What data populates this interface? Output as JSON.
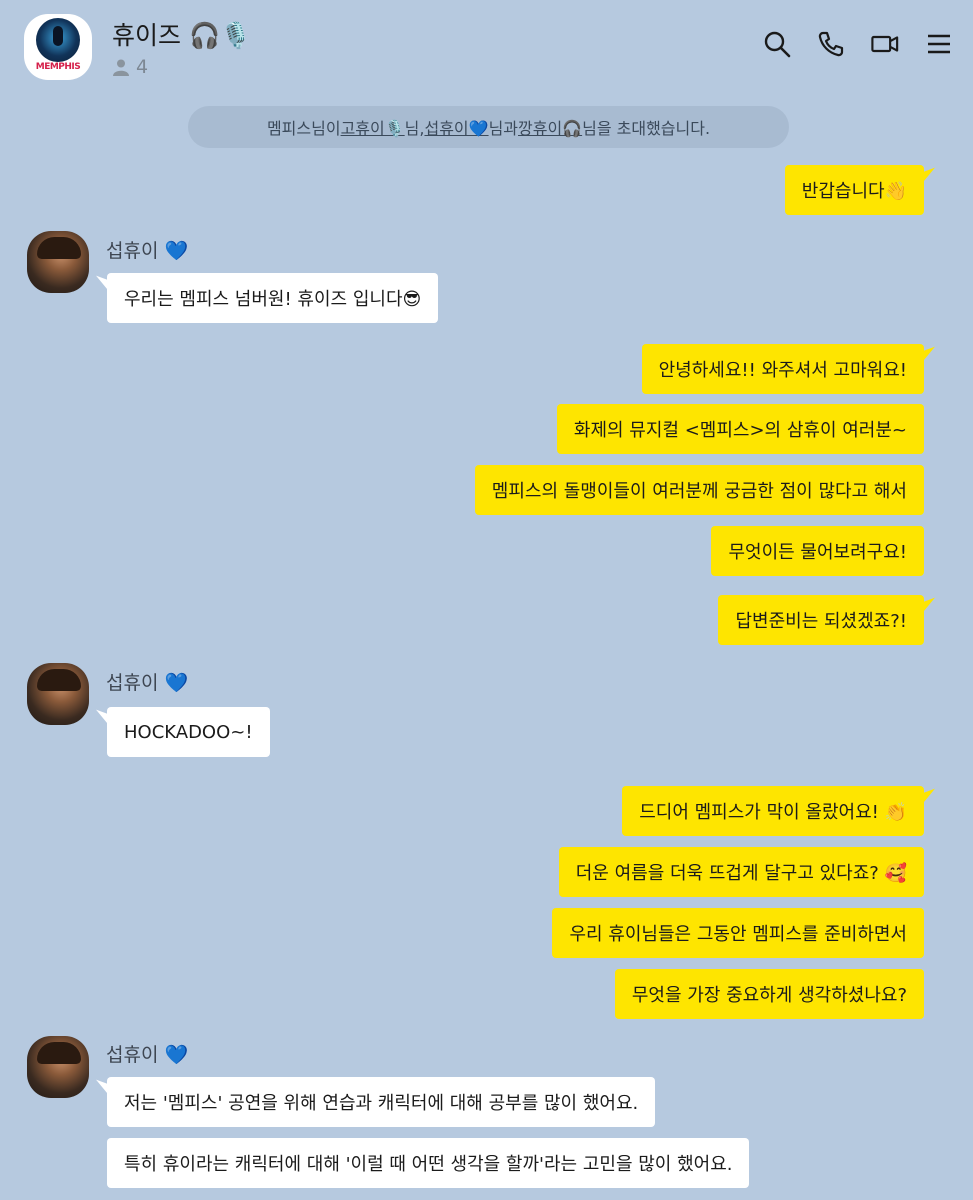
{
  "header": {
    "room_title": "휴이즈 🎧🎙️",
    "member_count": "4",
    "avatar_brand": "MEMPHIS"
  },
  "system_message": {
    "prefix": "멤피스님이 ",
    "user1": "고휴이🎙️",
    "mid1": "님, ",
    "user2": "섭휴이💙",
    "mid2": "님과 ",
    "user3": "깡휴이🎧",
    "suffix": "님을 초대했습니다."
  },
  "messages": [
    {
      "side": "out",
      "text": "반갑습니다👋"
    },
    {
      "side": "in",
      "sender": "섭휴이 💙",
      "text": "우리는 멤피스 넘버원! 휴이즈 입니다😎"
    },
    {
      "side": "out",
      "text": "안녕하세요!! 와주셔서 고마워요!"
    },
    {
      "side": "out",
      "text": "화제의 뮤지컬 <멤피스>의 삼휴이 여러분~"
    },
    {
      "side": "out",
      "text": "멤피스의 돌맹이들이 여러분께 궁금한 점이 많다고 해서"
    },
    {
      "side": "out",
      "text": "무엇이든 물어보려구요!"
    },
    {
      "side": "out",
      "text": "답변준비는 되셨겠죠?!"
    },
    {
      "side": "in",
      "sender": "섭휴이 💙",
      "text": "HOCKADOO~!"
    },
    {
      "side": "out",
      "text": "드디어 멤피스가 막이 올랐어요! 👏"
    },
    {
      "side": "out",
      "text": "더운 여름을 더욱 뜨겁게 달구고 있다죠? 🥰"
    },
    {
      "side": "out",
      "text": "우리 휴이님들은 그동안 멤피스를 준비하면서"
    },
    {
      "side": "out",
      "text": "무엇을 가장 중요하게 생각하셨나요?"
    },
    {
      "side": "in",
      "sender": "섭휴이 💙",
      "text": "저는 '멤피스' 공연을 위해 연습과 캐릭터에 대해 공부를 많이 했어요."
    },
    {
      "side": "in",
      "text": "특히 휴이라는 캐릭터에 대해 '이럴 때 어떤 생각을 할까'라는 고민을 많이 했어요."
    }
  ],
  "icons": {
    "search": "search-icon",
    "call": "phone-icon",
    "video": "video-call-icon",
    "menu": "menu-icon",
    "members": "person-icon"
  },
  "colors": {
    "background": "#b6c9df",
    "outgoing_bubble": "#fee500",
    "incoming_bubble": "#ffffff"
  }
}
